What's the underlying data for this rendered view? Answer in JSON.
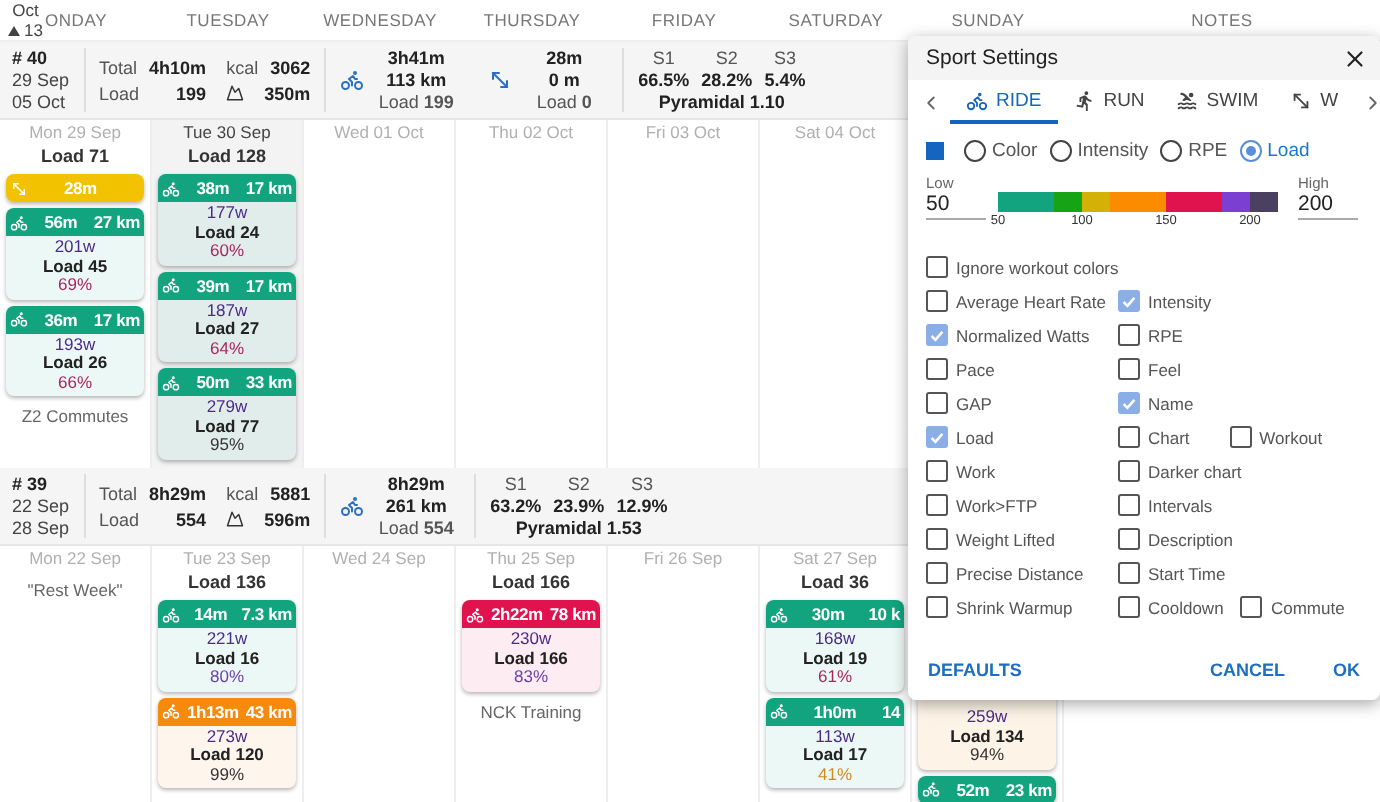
{
  "calendar_header": {
    "month": "Oct",
    "week": "13",
    "days": [
      "ONDAY",
      "TUESDAY",
      "WEDNESDAY",
      "THURSDAY",
      "FRIDAY",
      "SATURDAY",
      "SUNDAY",
      "NOTES"
    ]
  },
  "weeks": [
    {
      "number": "# 40",
      "start": "29 Sep",
      "end": "05 Oct",
      "totals": [
        {
          "kind": "label",
          "label": "Total",
          "value": "4h10m"
        },
        {
          "kind": "label",
          "label": "kcal",
          "value": "3062"
        },
        {
          "kind": "label",
          "label": "Load",
          "value": "199"
        },
        {
          "kind": "climb",
          "value": "350m"
        }
      ],
      "sports": [
        {
          "kind": "ride",
          "time": "3h41m",
          "distance": "113 km",
          "load": "Load **199**"
        },
        {
          "kind": "other",
          "time": "28m",
          "distance": "0 m",
          "load": "Load **0**"
        }
      ],
      "zones": [
        {
          "label": "S1",
          "value": "66.5%"
        },
        {
          "label": "S2",
          "value": "28.2%"
        },
        {
          "label": "S3",
          "value": "5.4%"
        }
      ],
      "pyramidal": "Pyramidal 1.10",
      "days": [
        {
          "date": "Mon 29 Sep",
          "today": false,
          "items": [
            {
              "kind": "load",
              "text": "Load 71"
            },
            {
              "kind": "other",
              "color": "#f2c200",
              "time": "28m"
            },
            {
              "kind": "ride",
              "color": "#12a37f",
              "time": "56m",
              "distance": "27 km",
              "watts": "201w",
              "load": "Load 45",
              "pct": {
                "text": "69%",
                "color": "#a8265e"
              }
            },
            {
              "kind": "ride",
              "color": "#12a37f",
              "time": "36m",
              "distance": "17 km",
              "watts": "193w",
              "load": "Load 26",
              "pct": {
                "text": "66%",
                "color": "#a8265e"
              }
            },
            {
              "kind": "note",
              "text": "Z2 Commutes"
            }
          ]
        },
        {
          "date": "Tue 30 Sep",
          "today": true,
          "items": [
            {
              "kind": "load",
              "text": "Load 128"
            },
            {
              "kind": "ride",
              "color": "#12a37f",
              "time": "38m",
              "distance": "17 km",
              "watts": "177w",
              "load": "Load 24",
              "pct": {
                "text": "60%",
                "color": "#a8265e"
              }
            },
            {
              "kind": "ride",
              "color": "#12a37f",
              "time": "39m",
              "distance": "17 km",
              "watts": "187w",
              "load": "Load 27",
              "pct": {
                "text": "64%",
                "color": "#a8265e"
              }
            },
            {
              "kind": "ride",
              "color": "#12a37f",
              "time": "50m",
              "distance": "33 km",
              "watts": "279w",
              "load": "Load 77",
              "pct": {
                "text": "95%",
                "color": "#333333"
              }
            }
          ]
        },
        {
          "date": "Wed 01 Oct",
          "today": false
        },
        {
          "date": "Thu 02 Oct",
          "today": false
        },
        {
          "date": "Fri 03 Oct",
          "today": false
        },
        {
          "date": "Sat 04 Oct",
          "today": false
        }
      ]
    },
    {
      "number": "# 39",
      "start": "22 Sep",
      "end": "28 Sep",
      "totals": [
        {
          "kind": "label",
          "label": "Total",
          "value": "8h29m"
        },
        {
          "kind": "label",
          "label": "kcal",
          "value": "5881"
        },
        {
          "kind": "label",
          "label": "Load",
          "value": "554"
        },
        {
          "kind": "climb",
          "value": "596m"
        }
      ],
      "sports": [
        {
          "kind": "ride",
          "time": "8h29m",
          "distance": "261 km",
          "load": "Load **554**"
        }
      ],
      "zones": [
        {
          "label": "S1",
          "value": "63.2%"
        },
        {
          "label": "S2",
          "value": "23.9%"
        },
        {
          "label": "S3",
          "value": "12.9%"
        }
      ],
      "pyramidal": "Pyramidal 1.53",
      "days": [
        {
          "date": "Mon 22 Sep",
          "today": false,
          "items": [
            {
              "kind": "note",
              "text": "\"Rest Week\""
            }
          ]
        },
        {
          "date": "Tue 23 Sep",
          "today": false,
          "items": [
            {
              "kind": "load",
              "text": "Load 136"
            },
            {
              "kind": "ride",
              "color": "#12a37f",
              "time": "14m",
              "distance": "7.3 km",
              "watts": "221w",
              "load": "Load 16",
              "pct": {
                "text": "80%",
                "color": "#6a3fb0"
              }
            },
            {
              "kind": "ride",
              "color": "#f58a0c",
              "time": "1h13m",
              "distance": "43 km",
              "watts": "273w",
              "load": "Load 120",
              "pct": {
                "text": "99%",
                "color": "#333333"
              }
            }
          ]
        },
        {
          "date": "Wed 24 Sep",
          "today": false
        },
        {
          "date": "Thu 25 Sep",
          "today": false,
          "items": [
            {
              "kind": "load",
              "text": "Load 166"
            },
            {
              "kind": "ride",
              "color": "#e0134f",
              "time": "2h22m",
              "distance": "78 km",
              "watts": "230w",
              "load": "Load 166",
              "pct": {
                "text": "83%",
                "color": "#6a3fb0"
              }
            },
            {
              "kind": "note",
              "text": "NCK Training"
            }
          ]
        },
        {
          "date": "Fri 26 Sep",
          "today": false
        },
        {
          "date": "Sat 27 Sep",
          "today": false,
          "items": [
            {
              "kind": "load",
              "text": "Load 36"
            },
            {
              "kind": "ride",
              "color": "#12a37f",
              "time": "30m",
              "distance": "10 k",
              "watts": "168w",
              "load": "Load 19",
              "pct": {
                "text": "61%",
                "color": "#a8265e"
              }
            },
            {
              "kind": "ride",
              "color": "#12a37f",
              "time": "1h0m",
              "distance": "14",
              "watts": "113w",
              "load": "Load 17",
              "pct": {
                "text": "41%",
                "color": "#d08a1f"
              }
            }
          ]
        },
        {
          "today": false,
          "items": [
            {
              "kind": "covered"
            },
            {
              "kind": "ride",
              "color": "#fdf3e6",
              "watts": "259w",
              "load": "Load 134",
              "pct": {
                "text": "94%",
                "color": "#333333"
              }
            },
            {
              "kind": "ride",
              "color": "#12a37f",
              "time": "52m",
              "distance": "23 km"
            }
          ]
        }
      ]
    }
  ],
  "dialog": {
    "title": "Sport Settings",
    "tabs": [
      {
        "label": "RIDE",
        "kind": "ride",
        "selected": true
      },
      {
        "label": "RUN",
        "kind": "run",
        "selected": false
      },
      {
        "label": "SWIM",
        "kind": "swim",
        "selected": false
      },
      {
        "label": "W",
        "kind": "other",
        "selected": false
      }
    ],
    "color_mode": [
      {
        "label": "Color",
        "selected": false
      },
      {
        "label": "Intensity",
        "selected": false
      },
      {
        "label": "RPE",
        "selected": false
      },
      {
        "label": "Load",
        "selected": true
      }
    ],
    "low": {
      "label": "Low",
      "value": "50"
    },
    "high": {
      "label": "High",
      "value": "200"
    },
    "scale": {
      "segments": [
        {
          "color": "#12a37f"
        },
        {
          "color": "#16a316"
        },
        {
          "color": "#d4b106"
        },
        {
          "color": "#fb8c00"
        },
        {
          "color": "#e0134f"
        },
        {
          "color": "#7b3fd1"
        },
        {
          "color": "#4a4060"
        }
      ],
      "ticks": [
        "50",
        "100",
        "150",
        "200"
      ]
    },
    "checkboxes": [
      [
        {
          "label": "Ignore workout colors",
          "checked": false
        }
      ],
      [
        {
          "label": "Average Heart Rate",
          "checked": false
        },
        {
          "label": "Intensity",
          "checked": true
        }
      ],
      [
        {
          "label": "Normalized Watts",
          "checked": true
        },
        {
          "label": "RPE",
          "checked": false
        }
      ],
      [
        {
          "label": "Pace",
          "checked": false
        },
        {
          "label": "Feel",
          "checked": false
        }
      ],
      [
        {
          "label": "GAP",
          "checked": false
        },
        {
          "label": "Name",
          "checked": true
        }
      ],
      [
        {
          "label": "Load",
          "checked": true
        },
        {
          "label": "Chart",
          "checked": false
        },
        {
          "label": "Workout",
          "checked": false
        }
      ],
      [
        {
          "label": "Work",
          "checked": false
        },
        {
          "label": "Darker chart",
          "checked": false
        }
      ],
      [
        {
          "label": "Work>FTP",
          "checked": false
        },
        {
          "label": "Intervals",
          "checked": false
        }
      ],
      [
        {
          "label": "Weight Lifted",
          "checked": false
        },
        {
          "label": "Description",
          "checked": false
        }
      ],
      [
        {
          "label": "Precise Distance",
          "checked": false
        },
        {
          "label": "Start Time",
          "checked": false
        }
      ],
      [
        {
          "label": "Shrink Warmup",
          "checked": false
        },
        {
          "label": "Cooldown",
          "checked": false
        },
        {
          "label": "Commute",
          "checked": false
        }
      ]
    ],
    "buttons": [
      {
        "kind": "left",
        "label": "DEFAULTS"
      },
      {
        "kind": "right",
        "label": "CANCEL"
      },
      {
        "kind": "right",
        "label": "OK"
      }
    ]
  }
}
